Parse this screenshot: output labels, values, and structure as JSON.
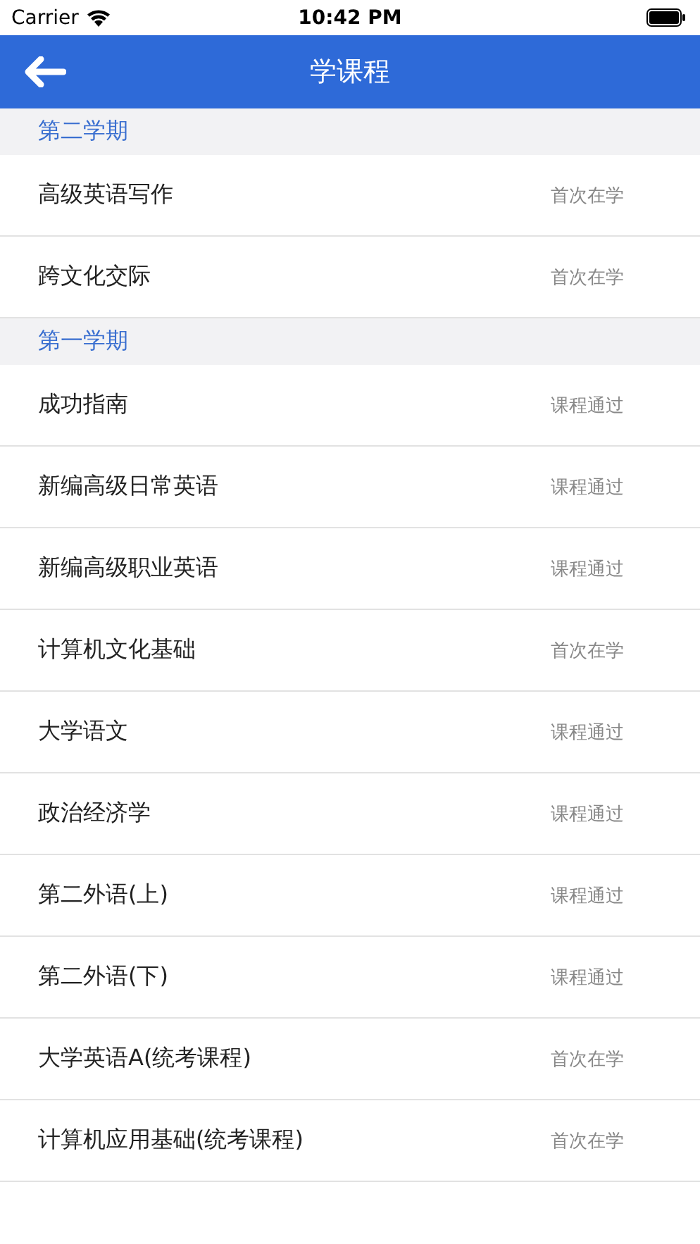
{
  "status_bar": {
    "carrier": "Carrier",
    "time": "10:42 PM"
  },
  "nav_bar": {
    "title": "学课程"
  },
  "sections": [
    {
      "title": "第二学期",
      "courses": [
        {
          "name": "高级英语写作",
          "status": "首次在学"
        },
        {
          "name": "跨文化交际",
          "status": "首次在学"
        }
      ]
    },
    {
      "title": "第一学期",
      "courses": [
        {
          "name": "成功指南",
          "status": "课程通过"
        },
        {
          "name": "新编高级日常英语",
          "status": "课程通过"
        },
        {
          "name": "新编高级职业英语",
          "status": "课程通过"
        },
        {
          "name": "计算机文化基础",
          "status": "首次在学"
        },
        {
          "name": "大学语文",
          "status": "课程通过"
        },
        {
          "name": "政治经济学",
          "status": "课程通过"
        },
        {
          "name": "第二外语(上)",
          "status": "课程通过"
        },
        {
          "name": "第二外语(下)",
          "status": "课程通过"
        },
        {
          "name": "大学英语A(统考课程)",
          "status": "首次在学"
        },
        {
          "name": "计算机应用基础(统考课程)",
          "status": "首次在学"
        }
      ]
    }
  ]
}
